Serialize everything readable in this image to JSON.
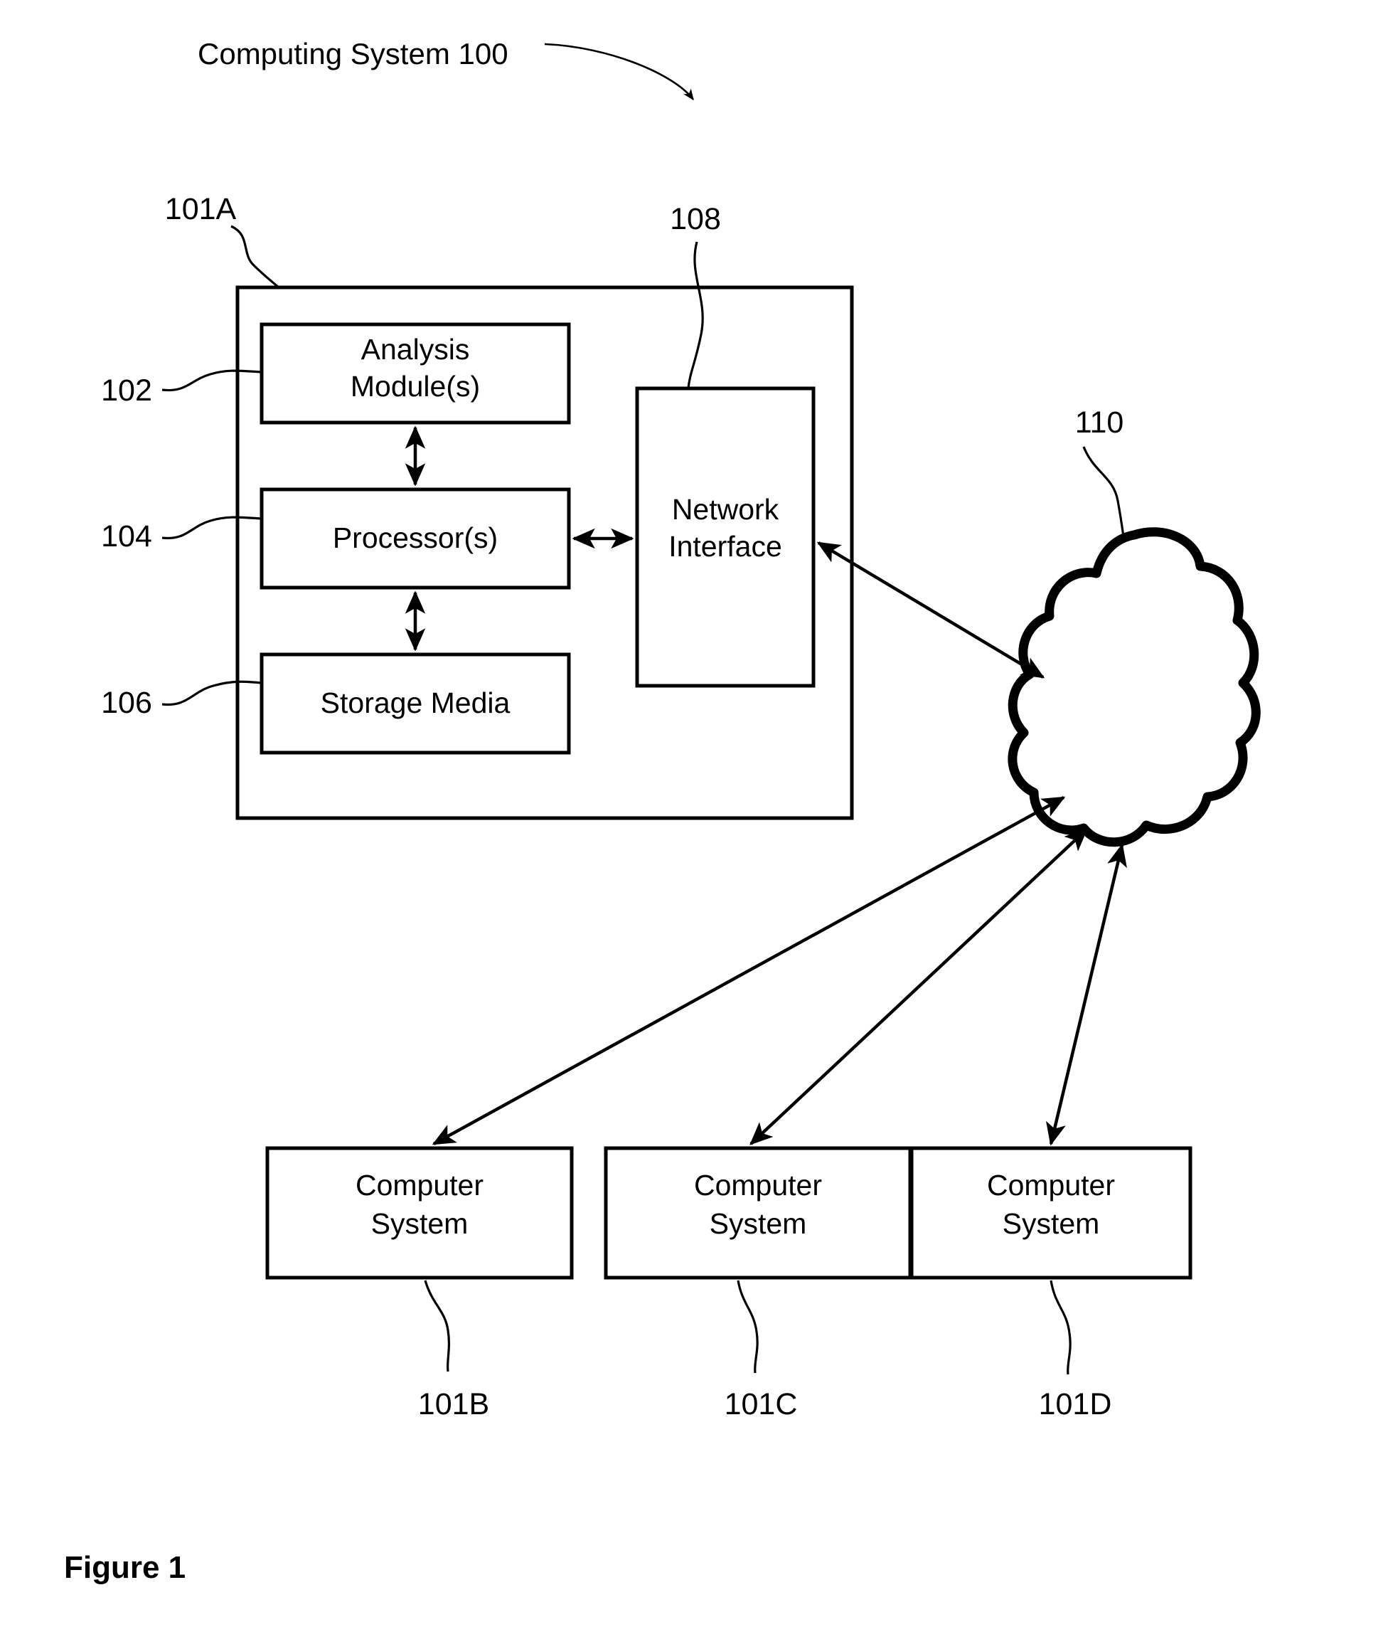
{
  "figure": {
    "title": "Computing System 100",
    "caption": "Figure 1"
  },
  "system_box": {
    "ref": "101A",
    "components": [
      {
        "ref": "102",
        "label_line1": "Analysis",
        "label_line2": "Module(s)"
      },
      {
        "ref": "104",
        "label_line1": "Processor(s)",
        "label_line2": ""
      },
      {
        "ref": "106",
        "label_line1": "Storage Media",
        "label_line2": ""
      },
      {
        "ref": "108",
        "label_line1": "Network",
        "label_line2": "Interface"
      }
    ]
  },
  "network": {
    "ref": "110",
    "name": "network-cloud"
  },
  "remote_systems": [
    {
      "ref": "101B",
      "label_line1": "Computer",
      "label_line2": "System"
    },
    {
      "ref": "101C",
      "label_line1": "Computer",
      "label_line2": "System"
    },
    {
      "ref": "101D",
      "label_line1": "Computer",
      "label_line2": "System"
    }
  ],
  "colors": {
    "stroke": "#000000",
    "background": "#ffffff"
  }
}
